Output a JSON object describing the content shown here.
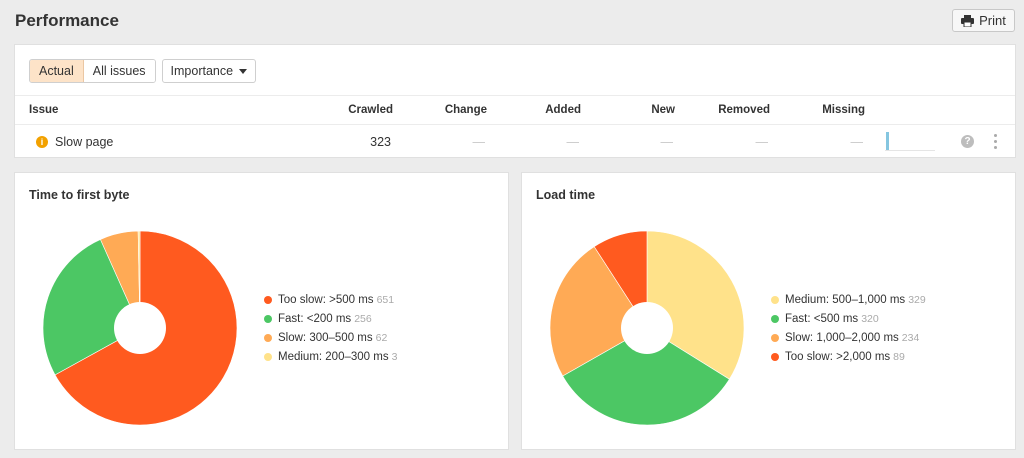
{
  "header": {
    "title": "Performance",
    "print_label": "Print"
  },
  "filters": {
    "tab_actual": "Actual",
    "tab_all_issues": "All issues",
    "importance_label": "Importance"
  },
  "table": {
    "columns": {
      "issue": "Issue",
      "crawled": "Crawled",
      "change": "Change",
      "added": "Added",
      "new": "New",
      "removed": "Removed",
      "missing": "Missing"
    },
    "rows": [
      {
        "issue": "Slow page",
        "crawled": "323",
        "change": "—",
        "added": "—",
        "new": "—",
        "removed": "—",
        "missing": "—"
      }
    ]
  },
  "icons": {
    "print": "printer-icon",
    "info": "info-icon",
    "help": "help-icon",
    "more": "more-vertical-icon"
  },
  "chart_data": [
    {
      "type": "pie",
      "title": "Time to first byte",
      "donut": true,
      "slices": [
        {
          "label": "Too slow: >500 ms",
          "value": 651,
          "color": "#ff5a1f"
        },
        {
          "label": "Fast: <200 ms",
          "value": 256,
          "color": "#4cc764"
        },
        {
          "label": "Slow: 300–500 ms",
          "value": 62,
          "color": "#ffaa55"
        },
        {
          "label": "Medium: 200–300 ms",
          "value": 3,
          "color": "#ffe28a"
        }
      ]
    },
    {
      "type": "pie",
      "title": "Load time",
      "donut": true,
      "slices": [
        {
          "label": "Medium: 500–1,000 ms",
          "value": 329,
          "color": "#ffe28a"
        },
        {
          "label": "Fast: <500 ms",
          "value": 320,
          "color": "#4cc764"
        },
        {
          "label": "Slow: 1,000–2,000 ms",
          "value": 234,
          "color": "#ffaa55"
        },
        {
          "label": "Too slow: >2,000 ms",
          "value": 89,
          "color": "#ff5a1f"
        }
      ]
    }
  ]
}
